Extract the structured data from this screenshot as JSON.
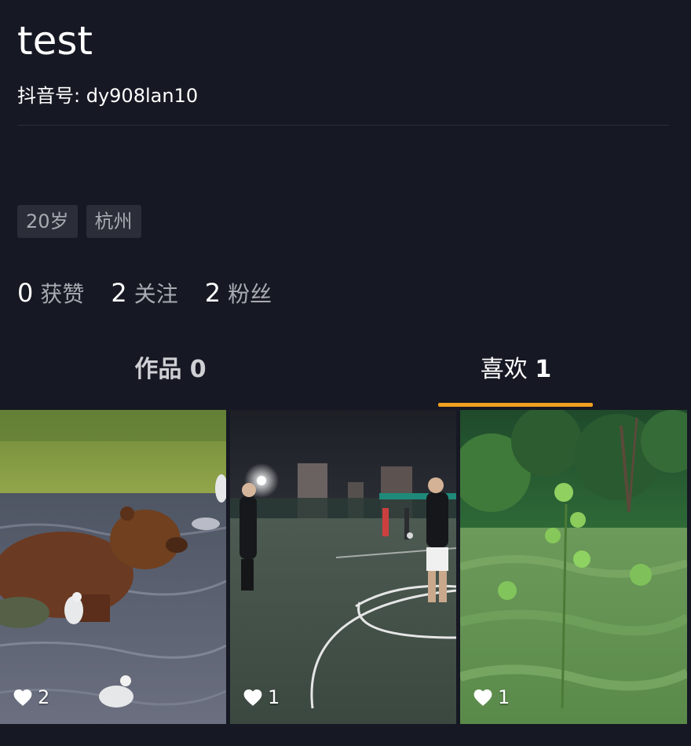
{
  "profile": {
    "name": "test",
    "account_id": "抖音号: dy908lan10",
    "tags": [
      "20岁",
      "杭州"
    ]
  },
  "stats": [
    {
      "value": "0",
      "label": "获赞"
    },
    {
      "value": "2",
      "label": "关注"
    },
    {
      "value": "2",
      "label": "粉丝"
    }
  ],
  "tabs": {
    "works": {
      "label": "作品",
      "count": "0"
    },
    "likes": {
      "label": "喜欢",
      "count": "1"
    },
    "active": "likes"
  },
  "videos": [
    {
      "scene": "bear in river with seagulls",
      "likes": "2"
    },
    {
      "scene": "basketball court at night",
      "likes": "1"
    },
    {
      "scene": "green forest meadow",
      "likes": "1"
    }
  ],
  "colors": {
    "background": "#161823",
    "tag_background": "#2b2d38",
    "muted_text": "#a9abb2",
    "tab_indicator": "#f0a020"
  },
  "icons": {
    "like": "heart-icon"
  }
}
